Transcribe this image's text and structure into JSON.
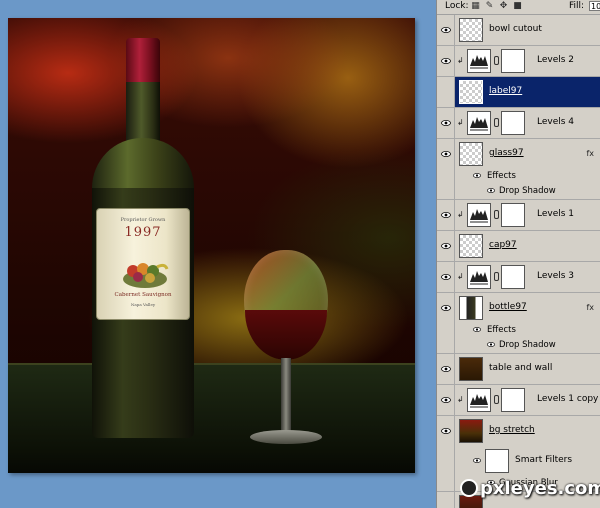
{
  "canvas": {
    "label": {
      "producer": "Proprietor Grown",
      "year": "1997",
      "varietal": "Cabernet Sauvignon",
      "region": "Napa Valley"
    }
  },
  "panel": {
    "lock_label": "Lock:",
    "fill_label": "Fill:",
    "fill_value": "10",
    "layers": [
      {
        "name": "bowl cutout",
        "selected": false
      },
      {
        "name": "Levels 2",
        "selected": false
      },
      {
        "name": "label97",
        "selected": true
      },
      {
        "name": "Levels 4",
        "selected": false
      },
      {
        "name": "glass97",
        "selected": false
      },
      {
        "name": "Levels 1",
        "selected": false
      },
      {
        "name": "cap97",
        "selected": false
      },
      {
        "name": "Levels 3",
        "selected": false
      },
      {
        "name": "bottle97",
        "selected": false
      },
      {
        "name": "table and wall",
        "selected": false
      },
      {
        "name": "Levels 1 copy",
        "selected": false
      },
      {
        "name": "bg stretch",
        "selected": false
      }
    ],
    "effects_label": "Effects",
    "drop_shadow_label": "Drop Shadow",
    "smart_filters_label": "Smart Filters",
    "gaussian_blur_label": "Gaussian Blur"
  },
  "watermark": "pxleyes.com",
  "colors": {
    "panel_bg": "#d4d0c8",
    "selected_row": "#0a246a",
    "desktop_bg": "#6b98c8"
  }
}
